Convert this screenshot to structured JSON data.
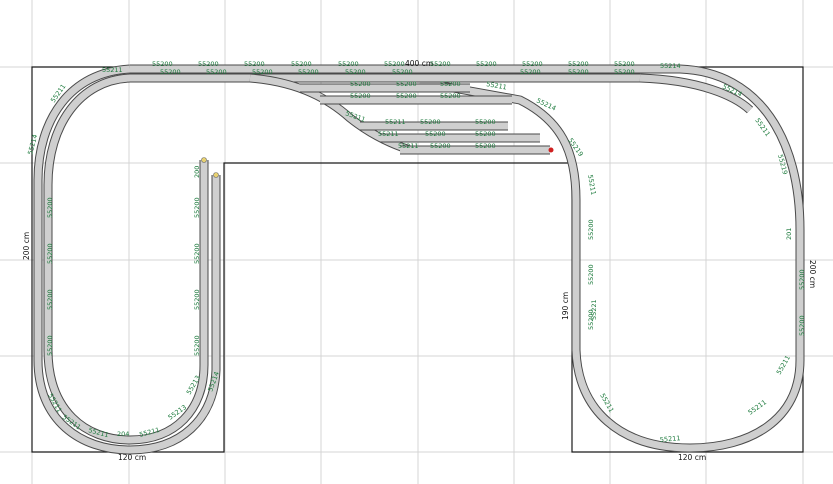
{
  "dimensions": {
    "top_width": "400 cm",
    "left_height": "200 cm",
    "right_height": "200 cm",
    "inner_height": "190 cm",
    "left_bottom": "120 cm",
    "right_bottom": "120 cm"
  },
  "part_labels": {
    "top_row": [
      "55200",
      "55200",
      "55200",
      "55200",
      "55200",
      "55200",
      "55200",
      "55200",
      "55200",
      "55200",
      "55200"
    ],
    "top_inner_row": [
      "55200",
      "55200",
      "55200",
      "55200",
      "55200",
      "55200",
      "55200",
      "55200",
      "55200"
    ],
    "siding_1": [
      "55200",
      "55200",
      "55200"
    ],
    "siding_2": [
      "55200",
      "55200",
      "55200"
    ],
    "siding_3": [
      "55200",
      "55200"
    ],
    "siding_4": [
      "55200",
      "55200"
    ],
    "siding_5": [
      "55200",
      "55200"
    ],
    "left_column": [
      "55200",
      "55200",
      "55200",
      "55200"
    ],
    "inner_column": [
      "200",
      "55200",
      "55200",
      "55200",
      "55200"
    ],
    "right_column": [
      "201",
      "55200",
      "55200"
    ],
    "right_inner_column": [
      "55200",
      "55200",
      "55200"
    ],
    "curves": [
      "55211",
      "55211",
      "55214",
      "55211",
      "55211",
      "204",
      "55211",
      "55211",
      "55213",
      "55213",
      "55214",
      "55214",
      "55219",
      "55211",
      "55214",
      "55214",
      "55211",
      "55219",
      "55211",
      "55211",
      "55211",
      "55211"
    ],
    "turnouts": [
      "55211",
      "55211",
      "55211",
      "55211",
      "55211",
      "55221"
    ]
  },
  "colors": {
    "label_green": "#1c7a3c",
    "track_fill": "#cfcfcf",
    "track_edge": "#4a4a4a",
    "grid": "#d4d4d4",
    "buffer_stop": "#d02020"
  }
}
